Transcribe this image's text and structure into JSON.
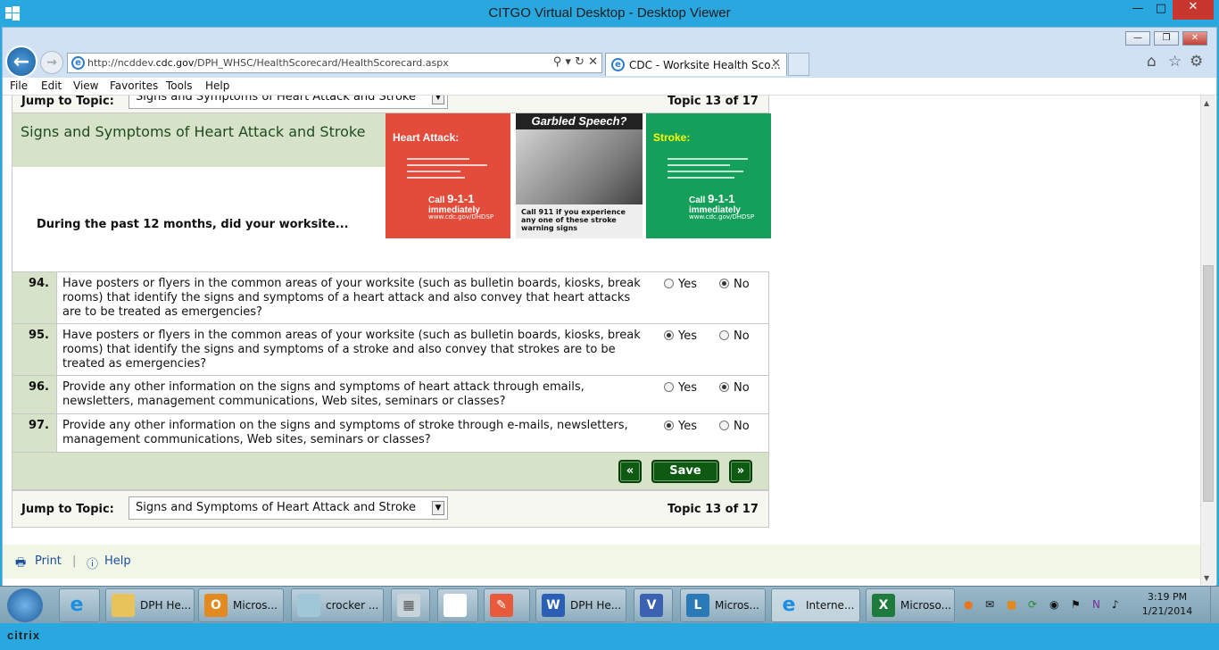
{
  "citrix_title": "CITGO Virtual Desktop - Desktop Viewer",
  "citrix_controls": {
    "minimize": "—",
    "restore": "□",
    "close": "✕"
  },
  "citrix_brand": "citrix",
  "ie": {
    "url_prefix": "http://ncddev.",
    "url_domain": "cdc.gov",
    "url_suffix": "/DPH_WHSC/HealthScorecard/HealthScorecard.aspx",
    "tab_title": "CDC - Worksite Health Sco...",
    "menu": [
      "File",
      "Edit",
      "View",
      "Favorites",
      "Tools",
      "Help"
    ]
  },
  "page": {
    "jump_label": "Jump to Topic:",
    "topic_select": "Signs and Symptoms of Heart Attack and Stroke",
    "topic_counter": "Topic 13 of 17",
    "section_title": "Signs and Symptoms of Heart Attack and Stroke",
    "intro": "During the past 12 months, did your worksite...",
    "poster1": {
      "title": "Heart Attack:",
      "call": "Call",
      "num": "9-1-1",
      "tail": "immediately",
      "url": "www.cdc.gov/DHDSP"
    },
    "poster2": {
      "title": "Garbled Speech?",
      "foot": "Call 911 if you experience any one of these stroke warning signs"
    },
    "poster3": {
      "title": "Stroke:",
      "call": "Call",
      "num": "9-1-1",
      "tail": "immediately",
      "url": "www.cdc.gov/DHDSP"
    },
    "questions": [
      {
        "num": "94.",
        "text": "Have posters or flyers in the common areas of your worksite (such as bulletin boards, kiosks, break rooms) that identify the signs and symptoms of a heart attack and also convey that heart attacks are to be treated as emergencies?",
        "answer": "No"
      },
      {
        "num": "95.",
        "text": "Have posters or flyers in the common areas of your worksite (such as bulletin boards, kiosks, break rooms) that identify the signs and symptoms of a stroke and also convey that strokes are to be treated as emergencies?",
        "answer": "Yes"
      },
      {
        "num": "96.",
        "text": "Provide any other information on the signs and symptoms of heart attack through emails, newsletters, management communications, Web sites, seminars or classes?",
        "answer": "No"
      },
      {
        "num": "97.",
        "text": "Provide any other information on the signs and symptoms of stroke through e-mails, newsletters, management communications, Web sites, seminars or classes?",
        "answer": "Yes"
      }
    ],
    "yes_label": "Yes",
    "no_label": "No",
    "prev_label": "«",
    "save_label": "Save",
    "next_label": "»",
    "print_label": "Print",
    "help_label": "Help"
  },
  "taskbar": {
    "items": [
      "DPH He...",
      "Micros...",
      "crocker ...",
      "DPH He...",
      "Micros...",
      "Interne...",
      "Microso..."
    ],
    "time": "3:19 PM",
    "date": "1/21/2014"
  }
}
